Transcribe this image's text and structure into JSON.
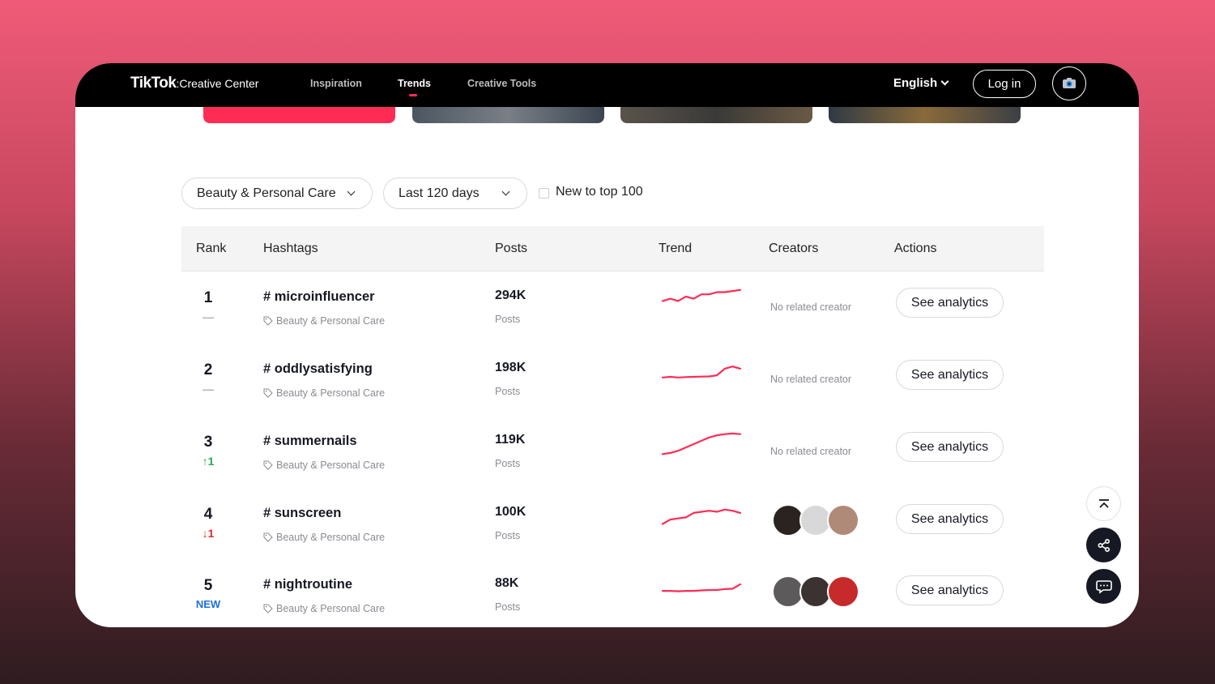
{
  "header": {
    "logo_brand": "TikTok",
    "logo_sub": ":Creative Center",
    "nav": [
      "Inspiration",
      "Trends",
      "Creative Tools"
    ],
    "active_nav": "Trends",
    "language": "English",
    "login_label": "Log in"
  },
  "filters": {
    "industry": "Beauty & Personal Care",
    "period": "Last 120 days",
    "new_to_top_label": "New to top 100"
  },
  "table": {
    "headers": [
      "Rank",
      "Hashtags",
      "Posts",
      "Trend",
      "Creators",
      "Actions"
    ],
    "rows": [
      {
        "rank": "1",
        "change": "—",
        "change_type": "none",
        "hashtag": "# microinfluencer",
        "category": "Beauty & Personal Care",
        "posts": "294K",
        "posts_label": "Posts",
        "trend": [
          5,
          6,
          5,
          7,
          6,
          8,
          8,
          9,
          9,
          9.5,
          10
        ],
        "creators_text": "No related creator",
        "creators": [],
        "action": "See analytics"
      },
      {
        "rank": "2",
        "change": "—",
        "change_type": "none",
        "hashtag": "# oddlysatisfying",
        "category": "Beauty & Personal Care",
        "posts": "198K",
        "posts_label": "Posts",
        "trend": [
          3,
          3.3,
          3,
          3.2,
          3.3,
          3.4,
          3.5,
          4,
          7,
          8,
          7
        ],
        "creators_text": "No related creator",
        "creators": [],
        "action": "See analytics"
      },
      {
        "rank": "3",
        "change": "↑1",
        "change_type": "up",
        "hashtag": "# summernails",
        "category": "Beauty & Personal Care",
        "posts": "119K",
        "posts_label": "Posts",
        "trend": [
          1,
          1.5,
          2.5,
          4,
          5.5,
          7,
          8.5,
          9.5,
          10,
          10.3,
          10
        ],
        "creators_text": "No related creator",
        "creators": [],
        "action": "See analytics"
      },
      {
        "rank": "4",
        "change": "↓1",
        "change_type": "down",
        "hashtag": "# sunscreen",
        "category": "Beauty & Personal Care",
        "posts": "100K",
        "posts_label": "Posts",
        "trend": [
          2,
          4,
          4.5,
          5,
          7,
          7.5,
          8,
          7.5,
          8.5,
          8,
          7
        ],
        "creators_text": "",
        "creators": [
          "creator-1",
          "creator-2",
          "creator-3"
        ],
        "action": "See analytics"
      },
      {
        "rank": "5",
        "change": "NEW",
        "change_type": "new",
        "hashtag": "# nightroutine",
        "category": "Beauty & Personal Care",
        "posts": "88K",
        "posts_label": "Posts",
        "trend": [
          4,
          4,
          3.8,
          4,
          4,
          4.2,
          4.4,
          4.4,
          4.8,
          5,
          7
        ],
        "creators_text": "",
        "creators": [
          "creator-4",
          "creator-5",
          "creator-6"
        ],
        "action": "See analytics"
      }
    ]
  },
  "colors": {
    "accent": "#fe2c55",
    "up": "#2fa84f",
    "down": "#e02a2a",
    "new": "#1e6fe0"
  },
  "fabs": [
    "back-to-top-icon",
    "share-icon",
    "feedback-icon"
  ]
}
